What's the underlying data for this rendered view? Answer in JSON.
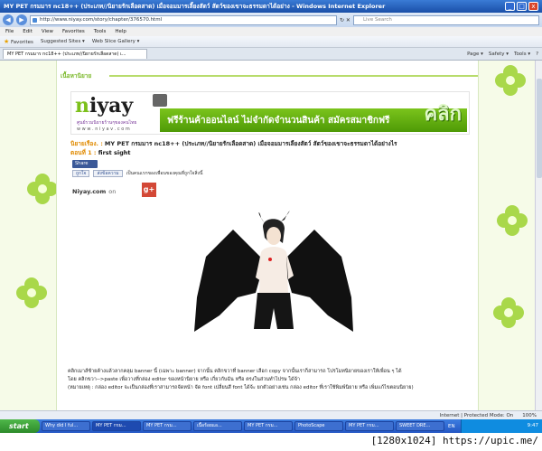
{
  "window": {
    "title": "MY PET กรมมาร nc18++ (ประเภท//นิยายรักเลือดสาด) เมื่อจอมมารเลี้ยงสัตว์ สัตว์ของเขาจะธรรมดาได้อย่าง - Windows Internet Explorer",
    "minimize": "_",
    "maximize": "□",
    "close": "x"
  },
  "address": {
    "url": "http://www.niyay.com/story/chapter/376570.html",
    "search_placeholder": "Live Search",
    "back": "◀",
    "forward": "▶",
    "refresh": "↻ ✕"
  },
  "menu": [
    "File",
    "Edit",
    "View",
    "Favorites",
    "Tools",
    "Help"
  ],
  "favorites": {
    "label": "Favorites",
    "items": [
      "Suggested Sites ▾",
      "Web Slice Gallery ▾"
    ]
  },
  "tab": {
    "label": "MY PET กรมมาร nc18++ (ประเภท//นิยายรักเลือดสาด) เ...",
    "tools": [
      "Page ▾",
      "Safety ▾",
      "Tools ▾",
      "?"
    ]
  },
  "page": {
    "section_heading": "เนื้อหานิยาย",
    "banner": {
      "logo_n": "n",
      "logo_rest": "iyay",
      "tagline": "ศูนย์รวมนิยายร้านๆของคนไทย",
      "site": "w w w . n i y a v . c o m",
      "promo": "ฟรีร้านค้าออนไลน์ ไม่จำกัดจำนวนสินค้า สมัครสมาชิกฟรี",
      "click": "คลิก"
    },
    "novel_label": "นิยายเรื่อง. :",
    "novel_title": "MY PET กรมมาร nc18++ (ประเภท//นิยายรักเลือดสาด) เมื่อจอมมารเลี้ยงสัตว์ สัตว์ของเขาจะธรรมดาได้อย่างไร",
    "chapter_label": "ตอนที่ 1 :",
    "chapter_title": "first sight",
    "share_label": "Share",
    "like_label": "ถูกใจ",
    "send_label": "ส่งข้อความ",
    "fb_text": "เป็นคนแรกของเพื่อนของคุณที่ถูกใจสิ่งนี้",
    "niyay_com": "Niyay.com",
    "on_label": "on",
    "gplus": "g+",
    "paragraph_lines": [
      "คลิกเมาส์ซ้ายค้างแล้วลากคลุม banner นี้ (เฉพาะ banner) จากนั้น คลิกขวาที่ banner เลือก copy จากนั้นเราก็สามารถ โปรโมทนิยายของเราให้เพื่อน ๆ ได้",
      "โดย คลิกขวา-->paste เพื่อวางที่กล่อง editor ของหน้านิยาย หรือ เกี่ยวกับฉัน หรือ ตรงในส่วนทำไปรษ ได้จ้า",
      "(หมายเหตุ : กล่อง editor จะเป็นกล่องที่เราสามารถจัดหน้า จัด font เปลี่ยนสี font ได้จ้ะ ยกตัวอย่างเช่น กล่อง editor ที่เราใช้พิมพ์นิยาย หรือ เพิ่มแก้ไขตอนนิยาย)"
    ]
  },
  "statusbar": {
    "zone": "Internet | Protected Mode: On",
    "zoom": "100%"
  },
  "taskbar": {
    "start": "start",
    "tasks": [
      "Why did I ful...",
      "MY PET กรม...",
      "MY PET กรม...",
      "เนื้อร้อยแอ...",
      "MY PET กรม...",
      "PhotoScape",
      "MY PET กรม...",
      "SWEET DRE...",
      "MY PET กรม..."
    ],
    "lang": "EN",
    "clock": "9:47"
  },
  "watermark": "[1280x1024] https://upic.me/"
}
